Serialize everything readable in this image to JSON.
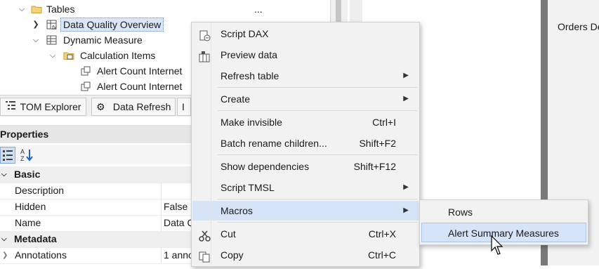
{
  "tree": {
    "items": [
      {
        "label": "Tables",
        "extra": "..."
      },
      {
        "label": "Data Quality Overview"
      },
      {
        "label": "Dynamic Measure"
      },
      {
        "label": "Calculation Items"
      },
      {
        "label": "Alert Count Internet"
      },
      {
        "label": "Alert Count Internet"
      }
    ]
  },
  "tabs": {
    "tom_explorer": "TOM Explorer",
    "data_refresh": "Data Refresh",
    "more": "I"
  },
  "properties": {
    "title": "Properties",
    "rows": [
      {
        "type": "category",
        "label": "Basic"
      },
      {
        "type": "prop",
        "name": "Description",
        "value": ""
      },
      {
        "type": "prop",
        "name": "Hidden",
        "value": "False"
      },
      {
        "type": "prop",
        "name": "Name",
        "value": "Data Q"
      },
      {
        "type": "category",
        "label": "Metadata"
      },
      {
        "type": "prop",
        "name": "Annotations",
        "value": "1 anno"
      }
    ]
  },
  "right_pane": {
    "header_text": "Orders De"
  },
  "context_menu": {
    "items": [
      {
        "label": "Script DAX",
        "icon": "script-icon"
      },
      {
        "label": "Preview data",
        "icon": "preview-icon"
      },
      {
        "label": "Refresh table",
        "submenu": true
      },
      {
        "label": "Create",
        "submenu": true
      },
      {
        "label": "Make invisible",
        "shortcut": "Ctrl+I"
      },
      {
        "label": "Batch rename children...",
        "shortcut": "Shift+F2"
      },
      {
        "label": "Show dependencies",
        "shortcut": "Shift+F12"
      },
      {
        "label": "Script TMSL",
        "submenu": true
      },
      {
        "label": "Macros",
        "submenu": true,
        "highlighted": true
      },
      {
        "label": "Cut",
        "shortcut": "Ctrl+X",
        "icon": "scissors-icon"
      },
      {
        "label": "Copy",
        "shortcut": "Ctrl+C",
        "icon": "copy-icon"
      }
    ]
  },
  "submenu": {
    "items": [
      {
        "label": "Rows"
      },
      {
        "label": "Alert Summary Measures",
        "highlighted": true
      }
    ]
  },
  "colors": {
    "highlight": "#d6e4f8",
    "menu_bg": "#f2f2f2",
    "selected_tree": "#dbe7f7"
  }
}
